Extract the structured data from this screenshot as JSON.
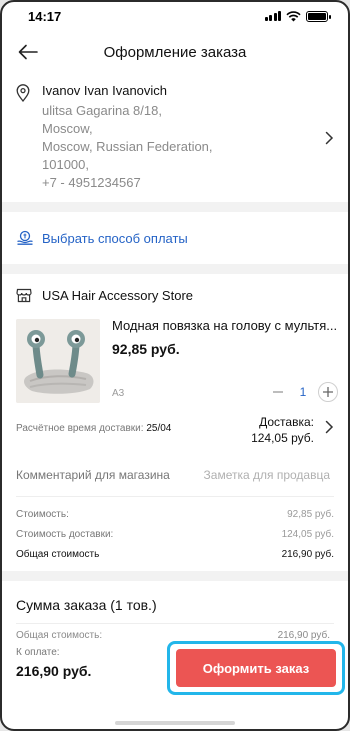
{
  "status_bar": {
    "time": "14:17"
  },
  "header": {
    "title": "Оформление заказа"
  },
  "address": {
    "name": "Ivanov Ivan Ivanovich",
    "lines": [
      "ulitsa Gagarina 8/18,",
      "Moscow,",
      "Moscow, Russian Federation,",
      "101000,",
      "+7 - 4951234567"
    ]
  },
  "payment": {
    "label": "Выбрать способ оплаты"
  },
  "store": {
    "name": "USA Hair Accessory Store"
  },
  "product": {
    "title": "Модная повязка на голову с мультя...",
    "price": "92,85 руб.",
    "variant": "A3",
    "quantity": "1"
  },
  "delivery": {
    "estimate_label": "Расчётное время доставки:",
    "estimate_date": "25/04",
    "cost_label": "Доставка:",
    "cost_value": "124,05 руб."
  },
  "comment": {
    "label": "Комментарий для магазина",
    "placeholder": "Заметка для продавца"
  },
  "costs": [
    {
      "label": "Стоимость:",
      "value": "92,85 руб."
    },
    {
      "label": "Стоимость доставки:",
      "value": "124,05 руб."
    },
    {
      "label": "Общая стоимость",
      "value": "216,90 руб."
    }
  ],
  "summary": {
    "title": "Сумма заказа (1 тов.)",
    "total_label": "Общая стоимость:",
    "total_value": "216,90 руб.",
    "pay_label": "К оплате:",
    "pay_amount": "216,90 руб.",
    "checkout_label": "Оформить заказ"
  },
  "colors": {
    "accent_link": "#2563c6",
    "checkout_button": "#ec5553",
    "highlight_outline": "#22b6ea"
  }
}
